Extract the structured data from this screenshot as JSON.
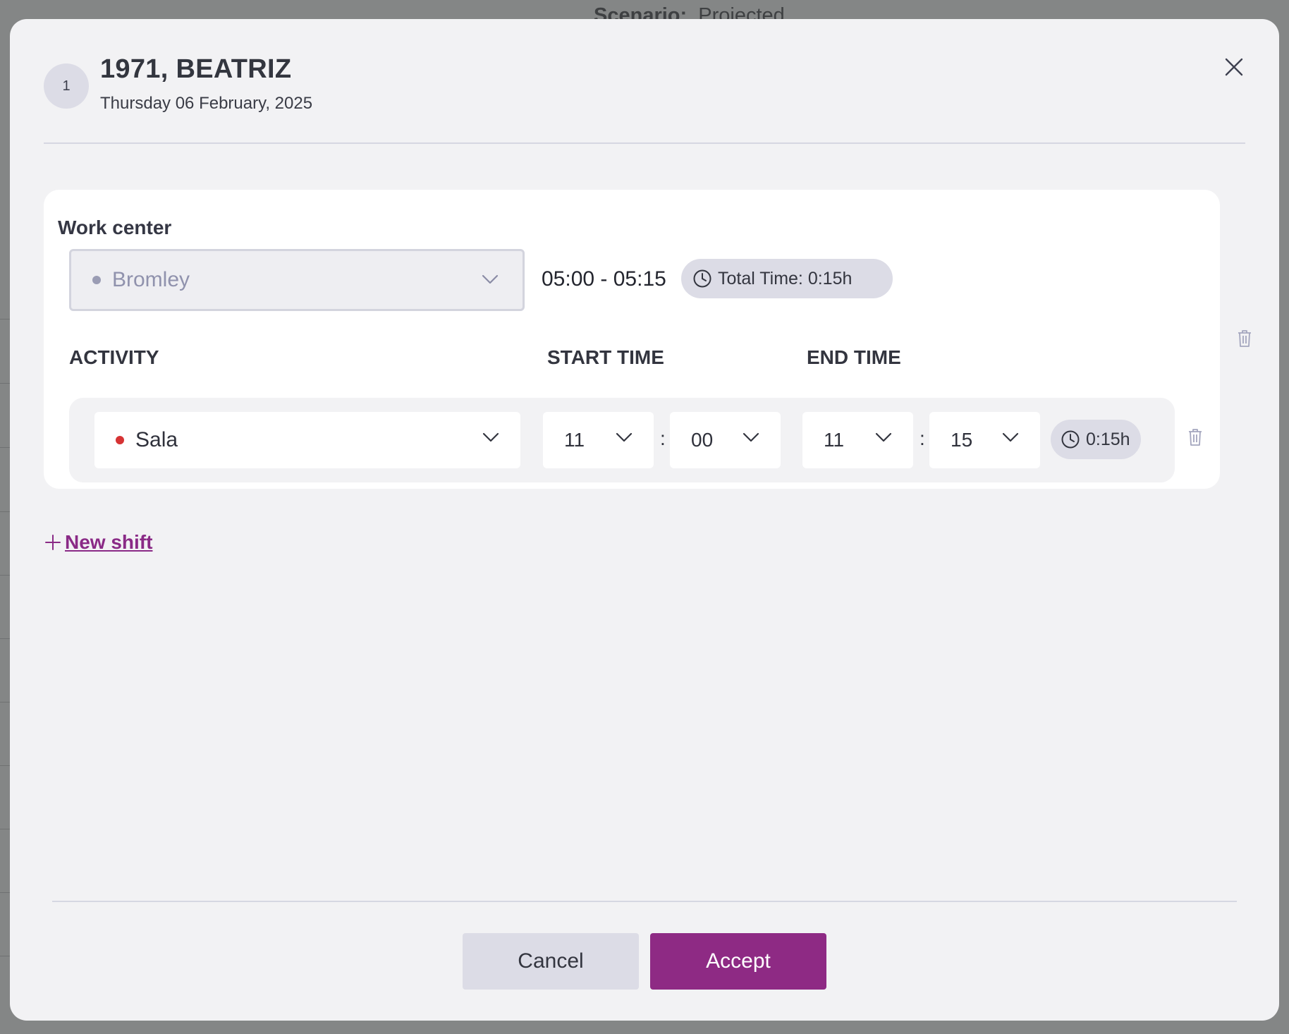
{
  "background": {
    "scenario_label": "Scenario:",
    "scenario_value": "Projected"
  },
  "modal": {
    "avatar_text": "1",
    "title": "1971, BEATRIZ",
    "date": "Thursday 06 February, 2025",
    "close_icon": "close-icon"
  },
  "shift": {
    "work_center_label": "Work center",
    "work_center_value": "Bromley",
    "work_center_dot_color": "#9a9cb4",
    "time_range": "05:00 - 05:15",
    "total_time": "Total Time: 0:15h",
    "columns": {
      "activity": "ACTIVITY",
      "start_time": "START TIME",
      "end_time": "END TIME"
    },
    "activities": [
      {
        "activity": "Sala",
        "dot_color": "#d63334",
        "start_hour": "11",
        "start_minute": "00",
        "end_hour": "11",
        "end_minute": "15",
        "duration": "0:15h"
      }
    ]
  },
  "new_shift_label": "New shift",
  "footer": {
    "cancel_label": "Cancel",
    "accept_label": "Accept"
  },
  "colors": {
    "accent": "#8e2a84",
    "link": "#8a2a86",
    "pill_bg": "#dcdce6"
  }
}
